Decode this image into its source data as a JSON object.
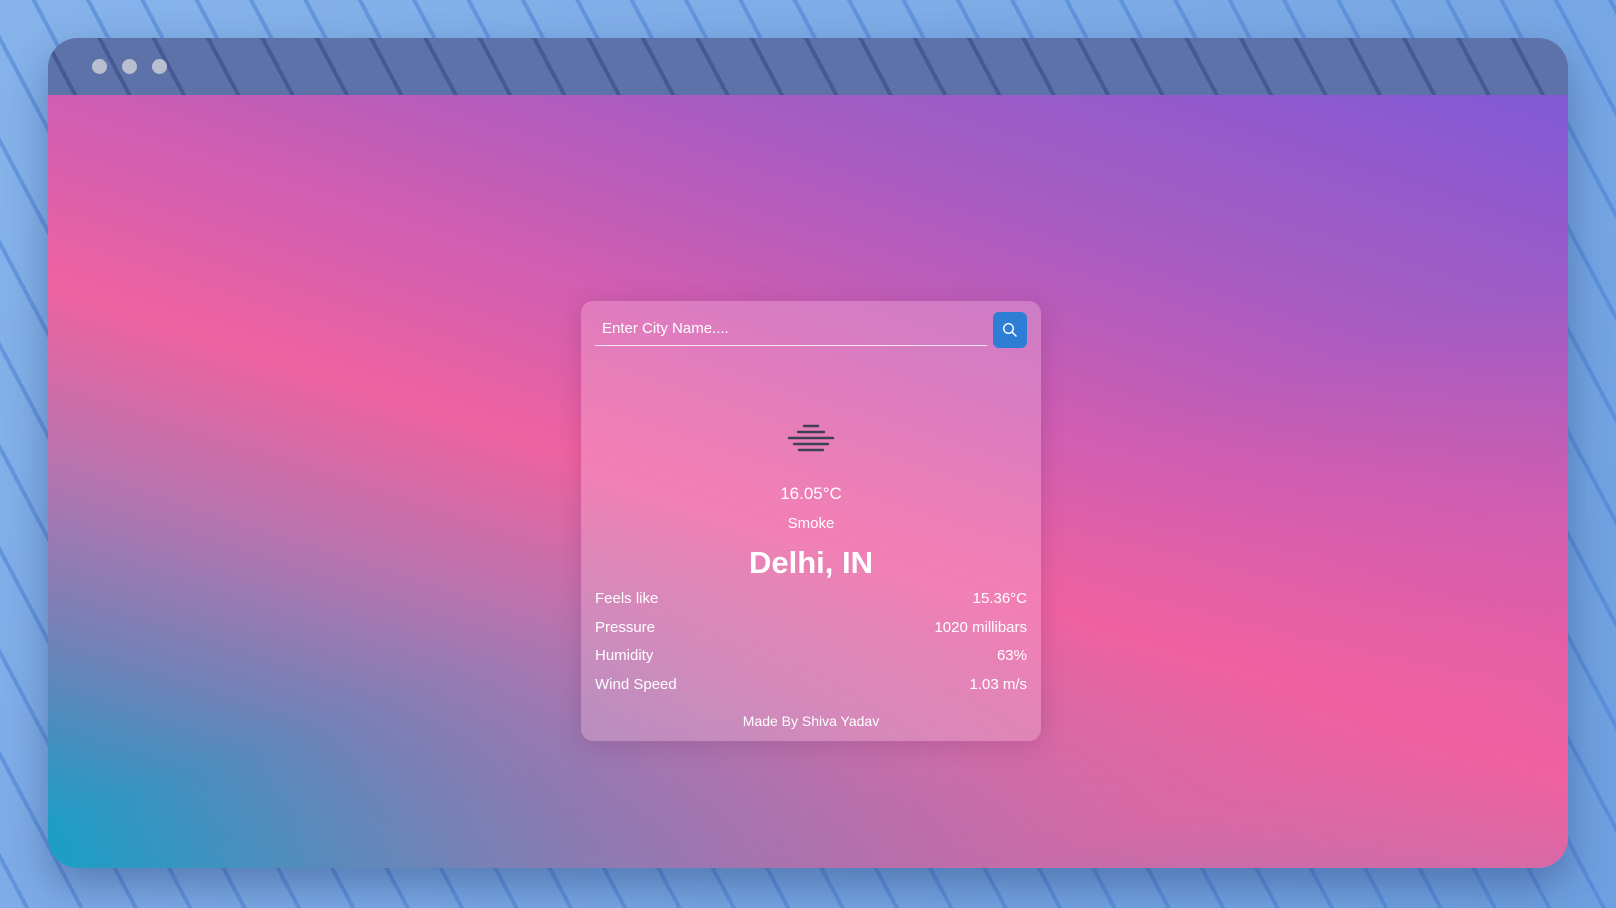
{
  "window": {
    "controls": [
      "close-dot",
      "minimize-dot",
      "maximize-dot"
    ]
  },
  "search": {
    "placeholder": "Enter City Name....",
    "value": "",
    "button_icon": "search-icon"
  },
  "weather": {
    "icon": "fog-haze-icon",
    "temperature": "16.05°C",
    "condition": "Smoke",
    "city": "Delhi, IN"
  },
  "details": [
    {
      "label": "Feels like",
      "value": "15.36°C"
    },
    {
      "label": "Pressure",
      "value": "1020 millibars"
    },
    {
      "label": "Humidity",
      "value": "63%"
    },
    {
      "label": "Wind Speed",
      "value": "1.03 m/s"
    }
  ],
  "footer": {
    "credit": "Made By Shiva Yadav"
  },
  "colors": {
    "accent_button": "#2f7ed6",
    "gradient_start": "#0aa3c9",
    "gradient_mid": "#ee62a1",
    "gradient_end": "#8259d6"
  }
}
